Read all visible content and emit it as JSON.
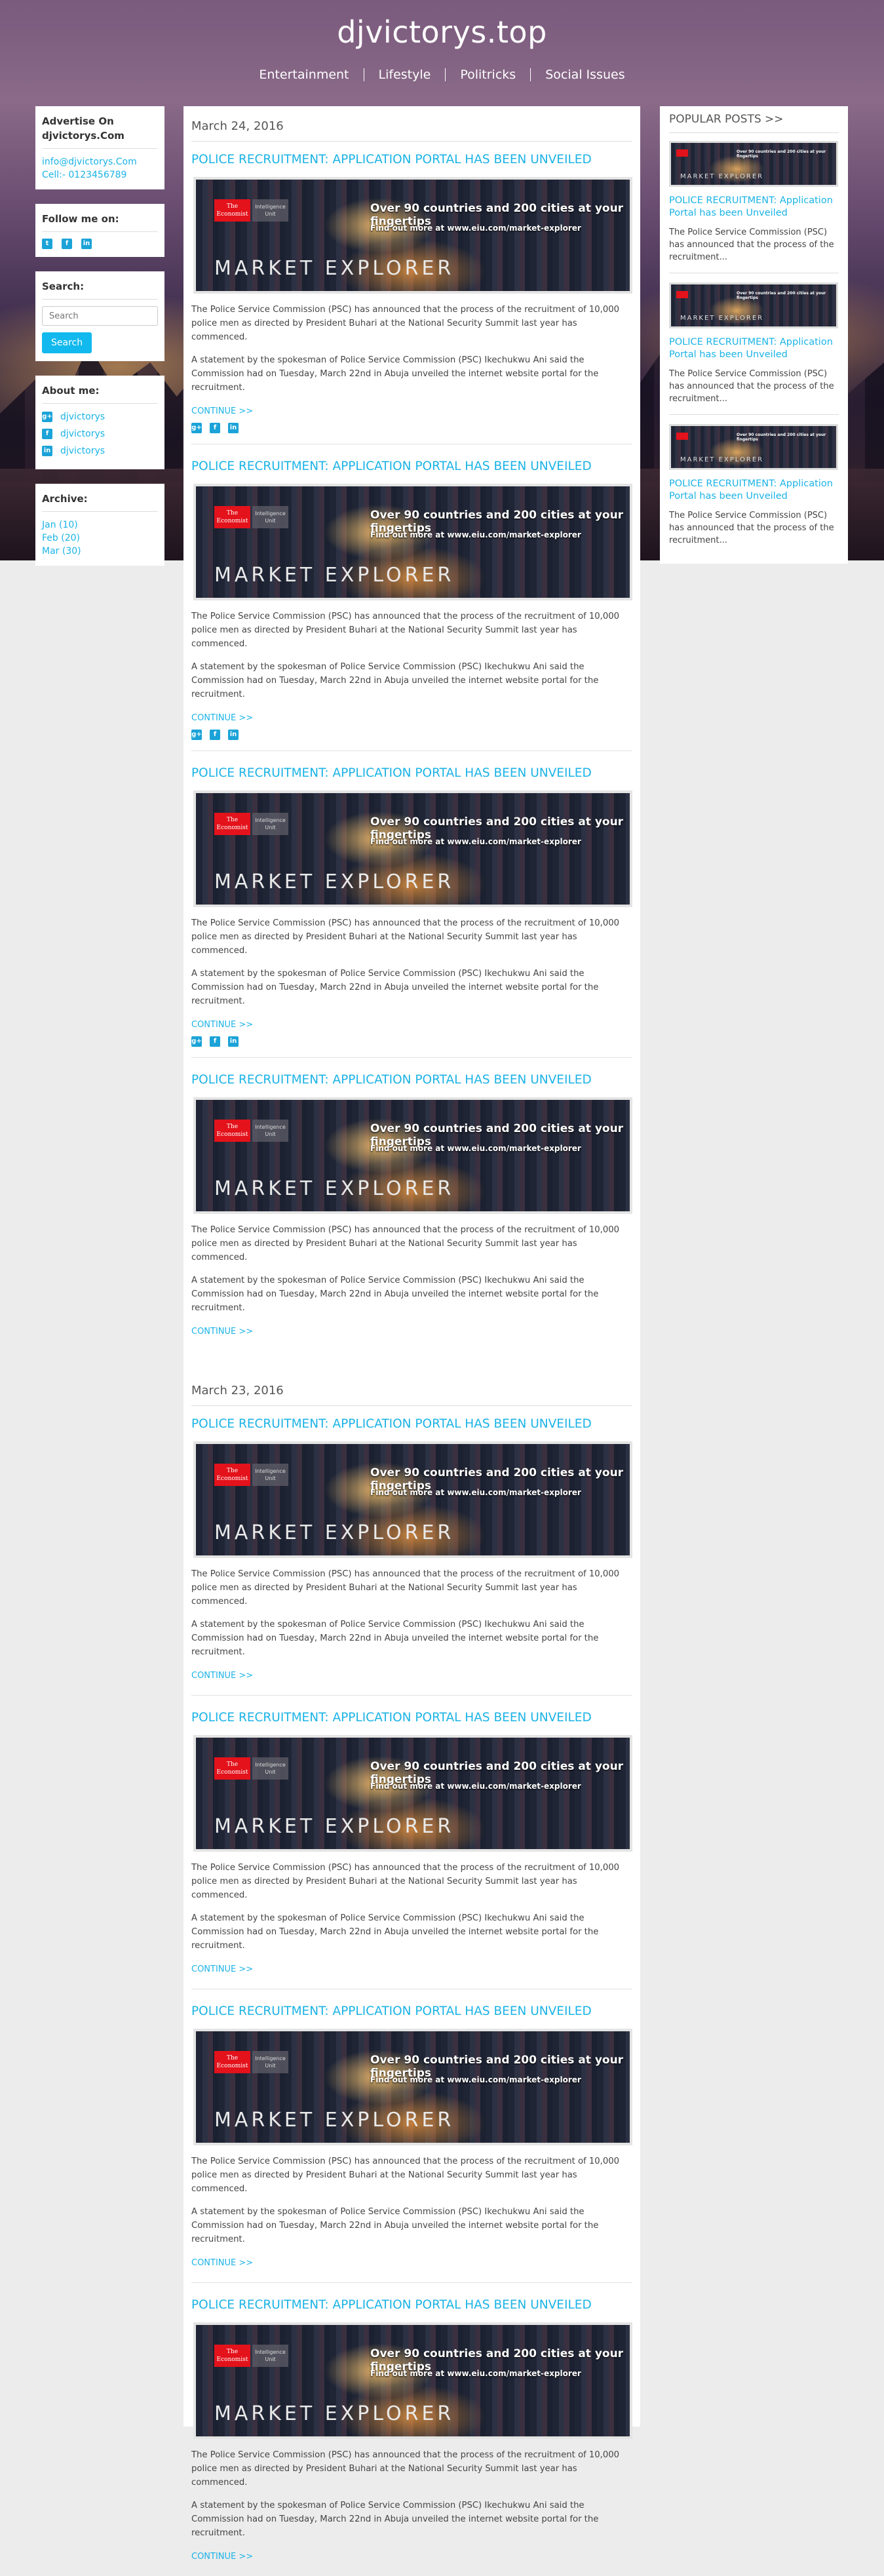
{
  "header": {
    "site_title": "djvictorys.top",
    "nav": [
      "Entertainment",
      "Lifestyle",
      "Politricks",
      "Social Issues"
    ]
  },
  "sidebar": {
    "advertise_title_line1": "Advertise On",
    "advertise_title_line2": "djvictorys.Com",
    "email": "info@djvictorys.Com",
    "cell": "Cell:- 0123456789",
    "follow_title": "Follow me on:",
    "search_title": "Search:",
    "search_placeholder": "Search",
    "search_button": "Search",
    "about_title": "About me:",
    "about_links": [
      "djvictorys",
      "djvictorys",
      "djvictorys"
    ],
    "archive_title": "Archive:",
    "archive": [
      "Jan (10)",
      "Feb (20)",
      "Mar (30)"
    ]
  },
  "icons": {
    "twitter": "twitter-icon",
    "facebook": "facebook-icon",
    "linkedin": "linkedin-icon",
    "googleplus": "googleplus-icon",
    "accent": "#1bb3e6"
  },
  "banner": {
    "brand": "The Economist",
    "brand2": "Intelligence Unit",
    "headline": "Over 90 countries and 200 cities at your fingertips",
    "sub": "Find out more at www.eiu.com/market-explorer",
    "wordmark": "MARKET EXPLORER"
  },
  "posts_common": {
    "title": "POLICE RECRUITMENT: APPLICATION PORTAL HAS BEEN UNVEILED",
    "p1": "The Police Service Commission (PSC) has announced that the process of the recruitment of 10,000 police men as directed by President Buhari at the National Security Summit last year has commenced.",
    "p2": "A statement by the spokesman of Police Service Commission (PSC) Ikechukwu Ani said the Commission had on Tuesday, March 22nd in Abuja unveiled the internet website portal for the recruitment.",
    "continue": "CONTINUE >>"
  },
  "groups": [
    {
      "date": "March 24, 2016"
    },
    {
      "date": "March 23, 2016"
    }
  ],
  "popular": {
    "title": "POPULAR POSTS >>",
    "item_title": "POLICE RECRUITMENT: Application Portal has been Unveiled",
    "item_body": "The Police Service Commission (PSC) has announced that the process of the recruitment..."
  }
}
